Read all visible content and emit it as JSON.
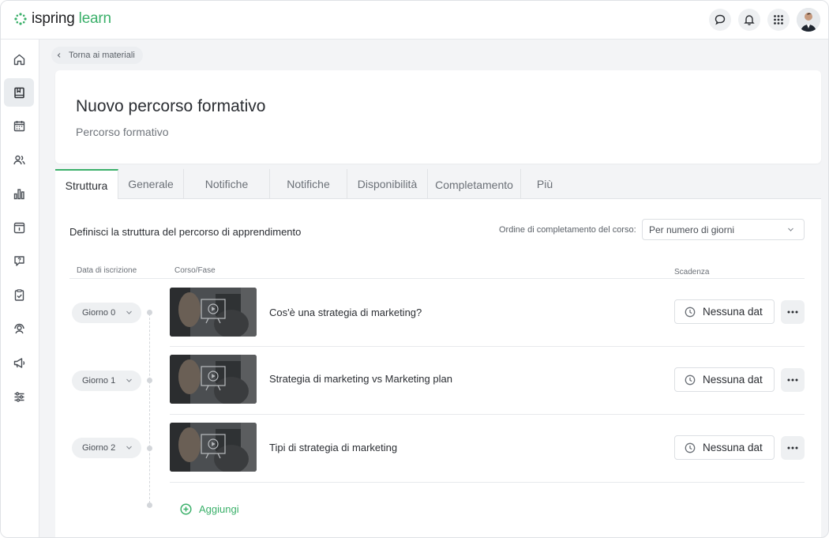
{
  "app": {
    "logo_word": "ispring",
    "logo_accent": "learn"
  },
  "colors": {
    "accent": "#3bb06a",
    "text": "#2b2e33",
    "muted": "#6b7077",
    "background": "#f3f4f6"
  },
  "topbar": {
    "icons": [
      "chat-icon",
      "bell-icon",
      "apps-grid-icon",
      "user-avatar"
    ]
  },
  "sidebar": {
    "items": [
      {
        "icon": "home-icon",
        "active": false
      },
      {
        "icon": "book-icon",
        "active": true
      },
      {
        "icon": "calendar-icon",
        "active": false
      },
      {
        "icon": "users-icon",
        "active": false
      },
      {
        "icon": "bar-chart-icon",
        "active": false
      },
      {
        "icon": "info-panel-icon",
        "active": false
      },
      {
        "icon": "question-bubble-icon",
        "active": false
      },
      {
        "icon": "clipboard-check-icon",
        "active": false
      },
      {
        "icon": "user-support-icon",
        "active": false
      },
      {
        "icon": "megaphone-icon",
        "active": false
      },
      {
        "icon": "sliders-icon",
        "active": false
      }
    ]
  },
  "breadcrumb": {
    "back_label": "Torna ai materiali"
  },
  "header": {
    "title": "Nuovo percorso formativo",
    "subtitle": "Percorso formativo"
  },
  "tabs": [
    {
      "label": "Struttura",
      "active": true
    },
    {
      "label": "Generale",
      "active": false
    },
    {
      "label": "Notifiche",
      "active": false
    },
    {
      "label": "Notifiche",
      "active": false
    },
    {
      "label": "Disponibilità",
      "active": false
    },
    {
      "label": "Completamento",
      "active": false
    },
    {
      "label": "Più",
      "active": false
    }
  ],
  "structure": {
    "title": "Definisci la struttura del percorso di apprendimento",
    "order_label": "Ordine di completamento del corso:",
    "order_value": "Per numero di giorni",
    "columns": {
      "enrollment": "Data di iscrizione",
      "course": "Corso/Fase",
      "deadline": "Scadenza"
    },
    "rows": [
      {
        "day": "Giorno 0",
        "course": "Cos'è una strategia di marketing?",
        "deadline": "Nessuna dat"
      },
      {
        "day": "Giorno 1",
        "course": "Strategia di marketing vs Marketing plan",
        "deadline": "Nessuna dat"
      },
      {
        "day": "Giorno 2",
        "course": "Tipi di strategia di marketing",
        "deadline": "Nessuna dat"
      }
    ],
    "add_label": "Aggiungi"
  }
}
